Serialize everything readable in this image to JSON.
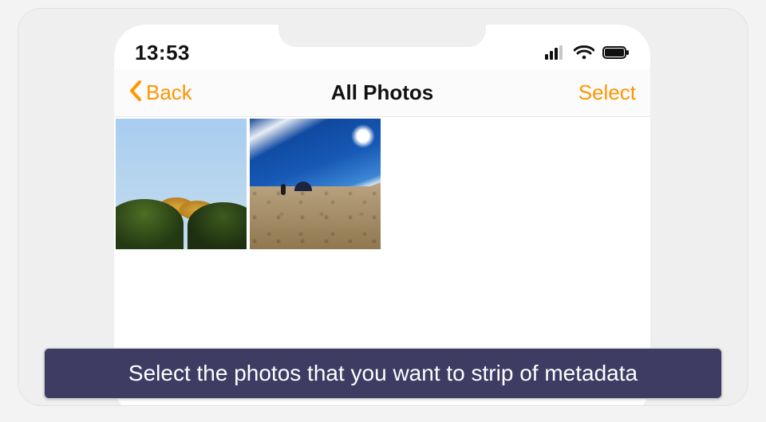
{
  "status": {
    "time": "13:53"
  },
  "nav": {
    "back_label": "Back",
    "title": "All Photos",
    "select_label": "Select"
  },
  "photos": [
    {
      "name": "photo-thumb-1"
    },
    {
      "name": "photo-thumb-2"
    }
  ],
  "caption": "Select the photos that you want to strip of metadata",
  "colors": {
    "accent": "#ff9500",
    "caption_bg": "#3e3c63"
  }
}
